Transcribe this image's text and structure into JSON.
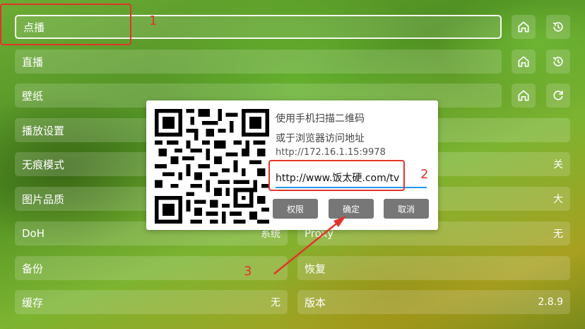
{
  "left_items": [
    {
      "label": "点播",
      "value": ""
    },
    {
      "label": "直播",
      "value": ""
    },
    {
      "label": "壁纸",
      "value": ""
    },
    {
      "label": "播放设置",
      "value": ""
    },
    {
      "label": "无痕模式",
      "value": ""
    },
    {
      "label": "图片品质",
      "value": ""
    },
    {
      "label": "DoH",
      "value": "系统"
    },
    {
      "label": "备份",
      "value": ""
    },
    {
      "label": "缓存",
      "value": "无"
    }
  ],
  "right_items": [
    {
      "label": "",
      "value": "关"
    },
    {
      "label": "",
      "value": "大"
    },
    {
      "label": "Proxy",
      "value": "无"
    },
    {
      "label": "恢复",
      "value": ""
    },
    {
      "label": "版本",
      "value": "2.8.9"
    }
  ],
  "side_buttons": {
    "vod_home": "home-icon",
    "vod_history": "history-icon",
    "live_home": "home-icon",
    "live_history": "history-icon",
    "wallpaper_home": "home-icon",
    "wallpaper_refresh": "refresh-icon"
  },
  "dialog": {
    "line1": "使用手机扫描二维码",
    "line2": "或于浏览器访问地址",
    "address": "http://172.16.1.15:9978",
    "url_value": "http://www.饭太硬.com/tv",
    "buttons": {
      "permission": "权限",
      "confirm": "确定",
      "cancel": "取消"
    }
  },
  "annotations": {
    "n1": "1",
    "n2": "2",
    "n3": "3"
  },
  "colors": {
    "annotation": "#e0352b",
    "input_underline": "#2196f3",
    "dialog_button": "#777777"
  }
}
